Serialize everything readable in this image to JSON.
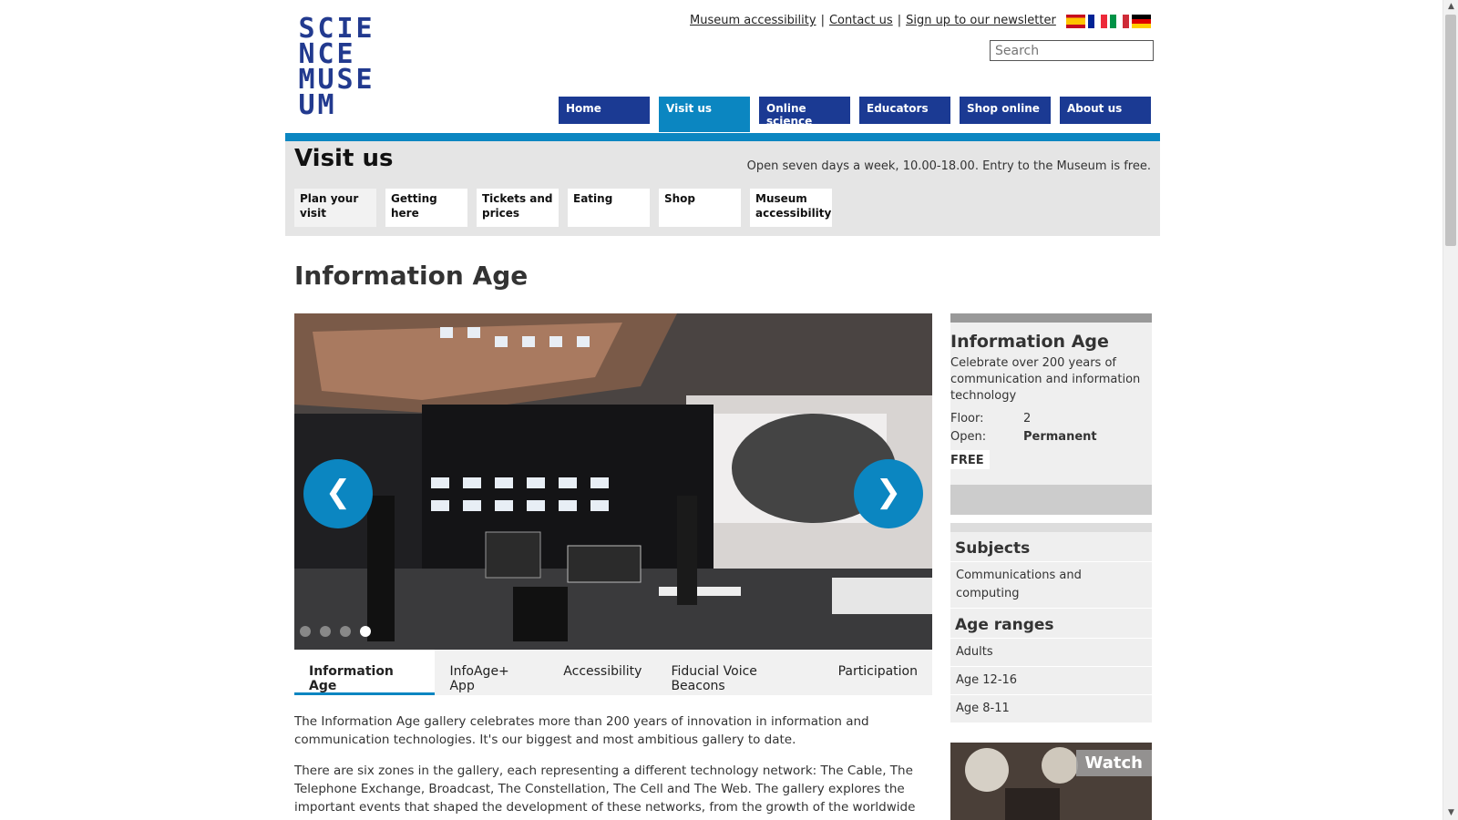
{
  "header": {
    "logo_letters": [
      "S",
      "C",
      "I",
      "E",
      "N",
      "C",
      "E",
      "",
      "M",
      "U",
      "S",
      "E",
      "U",
      "M",
      "",
      ""
    ],
    "top_links": [
      "Museum accessibility",
      "Contact us",
      "Sign up to our newsletter"
    ],
    "top_link_separator": "|",
    "languages": [
      "Spanish",
      "French",
      "Italian",
      "German"
    ],
    "search_placeholder": "Search"
  },
  "main_nav": [
    "Home",
    "Visit us",
    "Online science",
    "Educators",
    "Shop online",
    "About us"
  ],
  "main_nav_active": "Visit us",
  "section": {
    "title": "Visit us",
    "opening": "Open seven days a week, 10.00-18.00. Entry to the Museum is free.",
    "subnav": [
      "Plan your visit",
      "Getting here",
      "Tickets and prices",
      "Eating",
      "Shop",
      "Museum accessibility"
    ]
  },
  "page_title": "Information Age",
  "carousel": {
    "prev_icon": "chevron-left-icon",
    "next_icon": "chevron-right-icon",
    "prev_glyph": "❮",
    "next_glyph": "❯",
    "slide_count": 4,
    "active_slide": 4
  },
  "tabs": [
    "Information Age",
    "InfoAge+ App",
    "Accessibility",
    "Fiducial Voice Beacons",
    "Participation"
  ],
  "active_tab": "Information Age",
  "body": {
    "p1": "The Information Age gallery celebrates more than 200 years of innovation in information and communication technologies. It's our biggest and most ambitious gallery to date.",
    "p2": "There are six zones in the gallery, each representing a different technology network: The Cable, The Telephone Exchange, Broadcast, The Constellation, The Cell and The Web. The gallery explores the important events that shaped the development of these networks, from the growth of the worldwide"
  },
  "sidebar": {
    "title": "Information Age",
    "description": "Celebrate over 200 years of communication and information technology",
    "floor_label": "Floor:",
    "floor_value": "2",
    "open_label": "Open:",
    "open_value": "Permanent",
    "price": "FREE",
    "subjects_heading": "Subjects",
    "subjects": [
      "Communications and computing"
    ],
    "age_heading": "Age ranges",
    "ages": [
      "Adults",
      "Age 12-16",
      "Age 8-11"
    ],
    "watch_label": "Watch"
  },
  "colors": {
    "navy": "#1b3a93",
    "accent": "#0b86c1"
  }
}
